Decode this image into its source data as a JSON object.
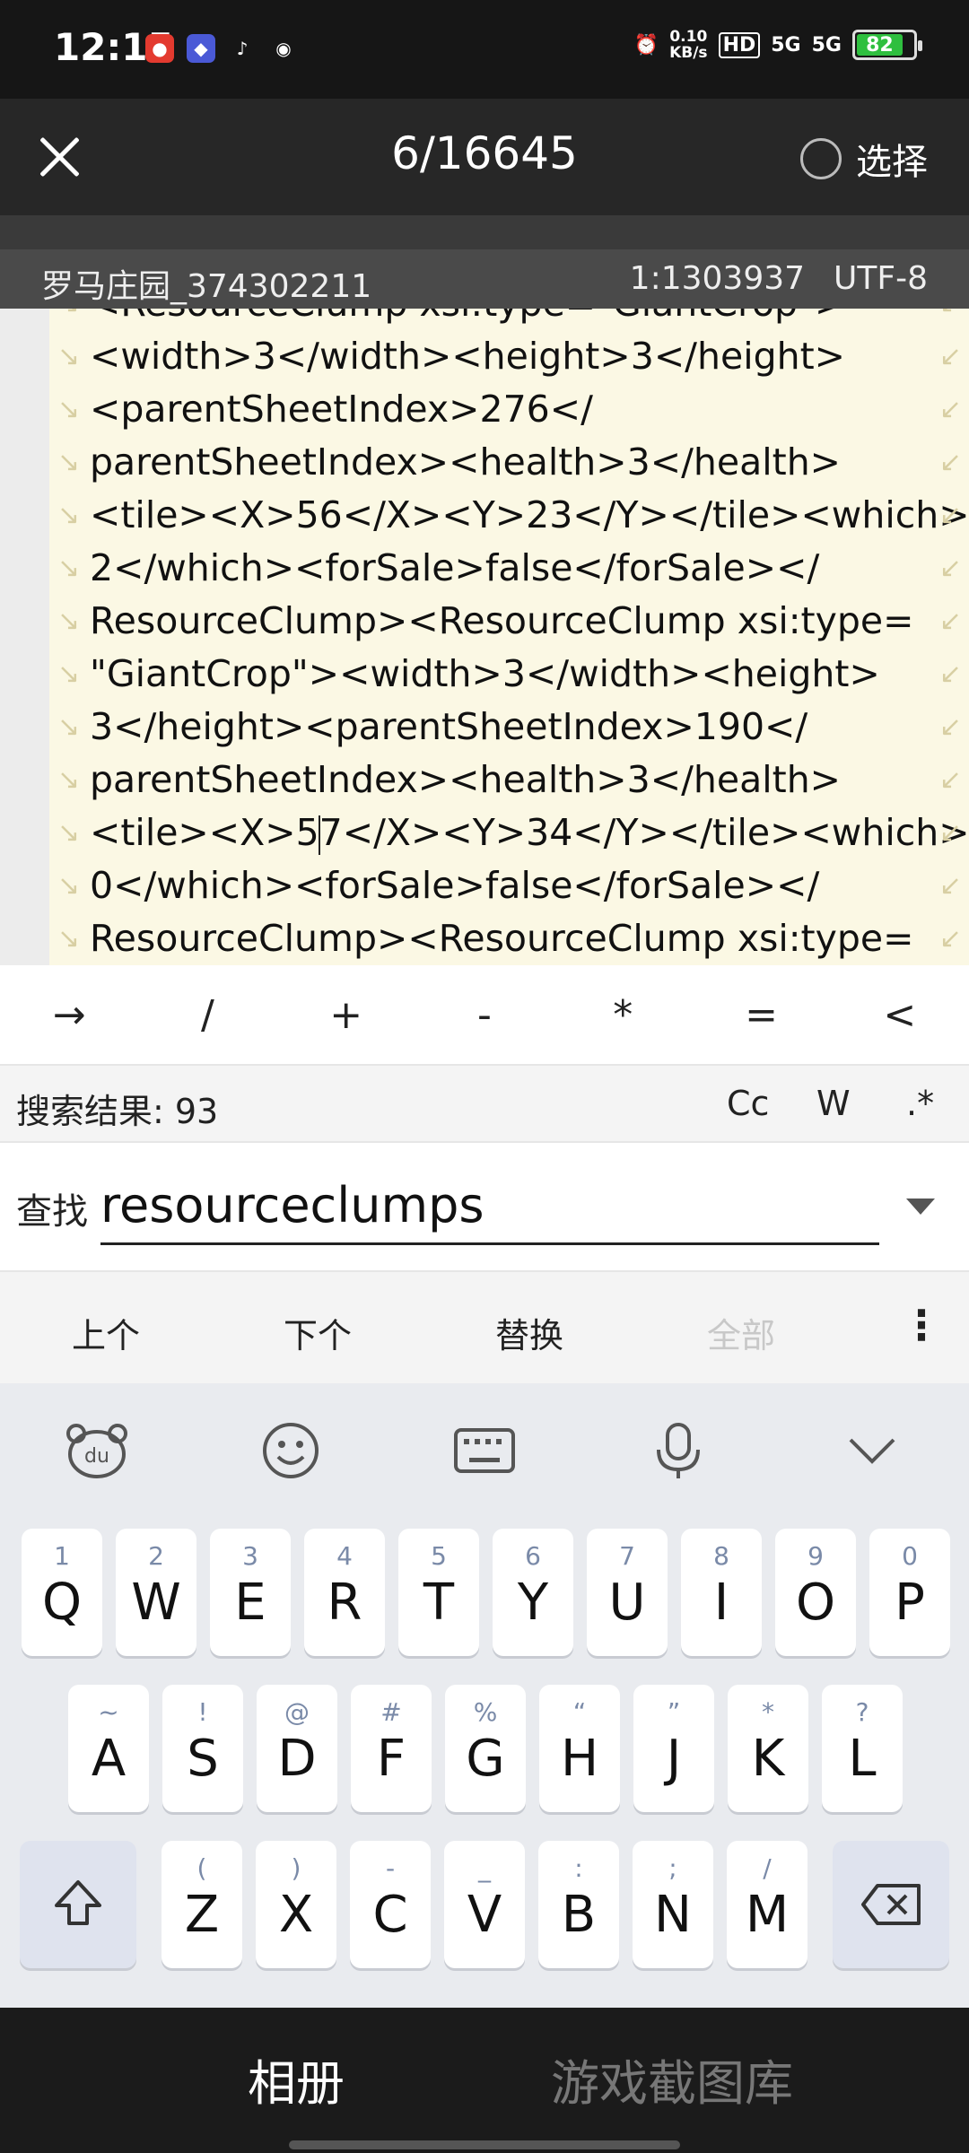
{
  "status_bar": {
    "time": "12:15",
    "net_speed_value": "0.10",
    "net_speed_unit": "KB/s",
    "hd_label": "HD",
    "signal_1": "5G",
    "signal_2": "5G",
    "battery": "82",
    "app_icons": [
      "app-icon-red",
      "app-icon-blue",
      "tiktok-icon",
      "wechat-icon"
    ]
  },
  "titlebar": {
    "counter": "6/16645",
    "select_label": "选择"
  },
  "info_bar": {
    "filename": "罗马庄园_374302211",
    "position": "1:1303937",
    "encoding": "UTF-8"
  },
  "editor": {
    "lines": [
      "<ResourceClump xsi:type=\"GiantCrop\">",
      "<width>3</width><height>3</height>",
      "<parentSheetIndex>276</",
      "parentSheetIndex><health>3</health>",
      "<tile><X>56</X><Y>23</Y></tile><which>",
      "2</which><forSale>false</forSale></",
      "ResourceClump><ResourceClump xsi:type=",
      "\"GiantCrop\"><width>3</width><height>",
      "3</height><parentSheetIndex>190</",
      "parentSheetIndex><health>3</health>",
      "<tile><X>5",
      "0</which><forSale>false</forSale></",
      "ResourceClump><ResourceClump xsi:type="
    ],
    "cursor_line_rest": "7</X><Y>34</Y></tile><which>"
  },
  "symbols": [
    "→",
    "/",
    "+",
    "-",
    "*",
    "=",
    "<"
  ],
  "search": {
    "result_label": "搜索结果: 93",
    "opt_case": "Cc",
    "opt_word": "W",
    "opt_regex": ".*",
    "find_label": "查找",
    "find_value": "resourceclumps"
  },
  "actions": {
    "prev": "上个",
    "next": "下个",
    "replace": "替换",
    "all": "全部",
    "more": "⋮"
  },
  "keyboard": {
    "row1": [
      {
        "main": "Q",
        "sub": "1"
      },
      {
        "main": "W",
        "sub": "2"
      },
      {
        "main": "E",
        "sub": "3"
      },
      {
        "main": "R",
        "sub": "4"
      },
      {
        "main": "T",
        "sub": "5"
      },
      {
        "main": "Y",
        "sub": "6"
      },
      {
        "main": "U",
        "sub": "7"
      },
      {
        "main": "I",
        "sub": "8"
      },
      {
        "main": "O",
        "sub": "9"
      },
      {
        "main": "P",
        "sub": "0"
      }
    ],
    "row2": [
      {
        "main": "A",
        "sub": "~"
      },
      {
        "main": "S",
        "sub": "!"
      },
      {
        "main": "D",
        "sub": "@"
      },
      {
        "main": "F",
        "sub": "#"
      },
      {
        "main": "G",
        "sub": "%"
      },
      {
        "main": "H",
        "sub": "“"
      },
      {
        "main": "J",
        "sub": "”"
      },
      {
        "main": "K",
        "sub": "*"
      },
      {
        "main": "L",
        "sub": "?"
      }
    ],
    "row3": [
      {
        "main": "Z",
        "sub": "("
      },
      {
        "main": "X",
        "sub": ")"
      },
      {
        "main": "C",
        "sub": "-"
      },
      {
        "main": "V",
        "sub": "_"
      },
      {
        "main": "B",
        "sub": ":"
      },
      {
        "main": "N",
        "sub": ";"
      },
      {
        "main": "M",
        "sub": "/"
      }
    ]
  },
  "bottom_tabs": {
    "album": "相册",
    "gallery": "游戏截图库"
  }
}
